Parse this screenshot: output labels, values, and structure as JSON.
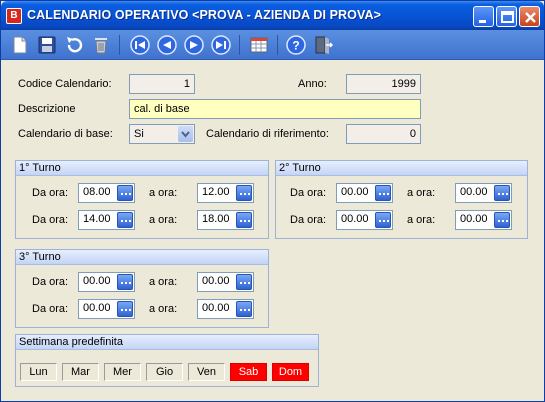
{
  "window": {
    "title": "CALENDARIO OPERATIVO <PROVA - AZIENDA DI PROVA>"
  },
  "toolbar": {
    "icons": [
      "new-document-icon",
      "save-icon",
      "undo-icon",
      "delete-icon",
      "first-record-icon",
      "previous-record-icon",
      "next-record-icon",
      "last-record-icon",
      "grid-view-icon",
      "help-icon",
      "exit-door-icon"
    ]
  },
  "form": {
    "codice_label": "Codice Calendario:",
    "codice_value": "1",
    "anno_label": "Anno:",
    "anno_value": "1999",
    "descrizione_label": "Descrizione",
    "descrizione_value": "cal. di base",
    "base_label": "Calendario di base:",
    "base_value": "Si",
    "riferimento_label": "Calendario di riferimento:",
    "riferimento_value": "0"
  },
  "turni": {
    "da_label": "Da ora:",
    "a_label": "a ora:",
    "t1": {
      "title": "1° Turno",
      "r1_da": "08.00",
      "r1_a": "12.00",
      "r2_da": "14.00",
      "r2_a": "18.00"
    },
    "t2": {
      "title": "2° Turno",
      "r1_da": "00.00",
      "r1_a": "00.00",
      "r2_da": "00.00",
      "r2_a": "00.00"
    },
    "t3": {
      "title": "3° Turno",
      "r1_da": "00.00",
      "r1_a": "00.00",
      "r2_da": "00.00",
      "r2_a": "00.00"
    }
  },
  "settimana": {
    "title": "Settimana predefinita",
    "days": [
      "Lun",
      "Mar",
      "Mer",
      "Gio",
      "Ven",
      "Sab",
      "Dom"
    ],
    "holiday_color": "#ff0000"
  }
}
